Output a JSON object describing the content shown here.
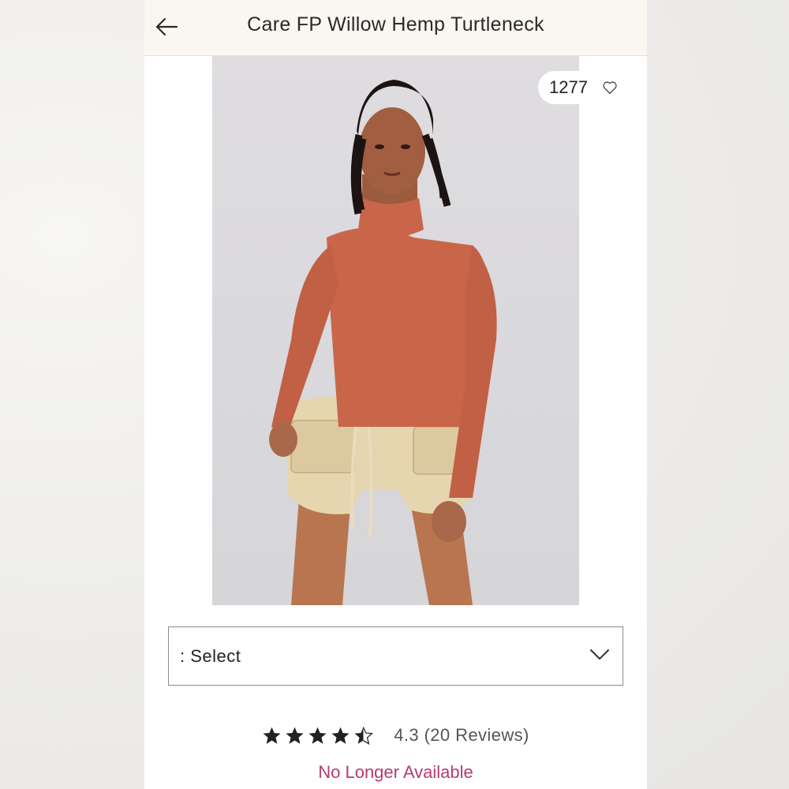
{
  "header": {
    "title": "Care FP Willow Hemp Turtleneck",
    "back_icon": "arrow-left-icon"
  },
  "product_image": {
    "description_icon": "product-photo",
    "favorites_count": "1277",
    "heart_icon": "heart-outline-icon"
  },
  "size_select": {
    "selected_value": ": Select",
    "chevron_icon": "chevron-down-icon"
  },
  "rating": {
    "score": 4.3,
    "text": "4.3 (20 Reviews)",
    "star_color": "#222222"
  },
  "availability": {
    "text": "No Longer Available",
    "color": "#b83a73"
  }
}
